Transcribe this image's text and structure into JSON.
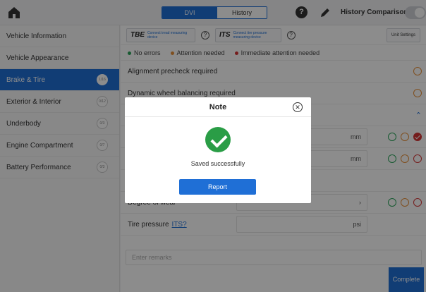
{
  "header": {
    "home_icon": "home-icon",
    "tabs": [
      "DVI",
      "History"
    ],
    "active_tab": "DVI",
    "history_comparison_label": "History Comparison",
    "history_comparison_on": false
  },
  "sidebar": {
    "items": [
      {
        "label": "Vehicle Information",
        "badge": ""
      },
      {
        "label": "Vehicle Appearance",
        "badge": ""
      },
      {
        "label": "Brake & Tire",
        "badge": "1/16",
        "active": true
      },
      {
        "label": "Exterior & Interior",
        "badge": "0/12"
      },
      {
        "label": "Underbody",
        "badge": "0/3"
      },
      {
        "label": "Engine Compartment",
        "badge": "0/7"
      },
      {
        "label": "Battery Performance",
        "badge": "0/3"
      }
    ]
  },
  "toolbar": {
    "tbe_logo": "TBE",
    "tbe_text": "Connect tread measuring device",
    "its_logo": "ITS",
    "its_text": "Connect tire pressure measuring device",
    "unit_settings": "Unit Settings"
  },
  "legend": {
    "no_errors": "No errors",
    "attention": "Attention needed",
    "immediate": "Immediate attention needed"
  },
  "rows": {
    "alignment": "Alignment precheck required",
    "dynamic_balancing": "Dynamic wheel balancing required",
    "mm_unit": "mm",
    "degree_of_wear": "Degree of wear",
    "tire_pressure": "Tire pressure",
    "its_link": "ITS?",
    "psi_unit": "psi",
    "remarks_placeholder": "Enter remarks"
  },
  "footer": {
    "complete": "Complete"
  },
  "modal": {
    "title": "Note",
    "message": "Saved successfully",
    "button": "Report"
  },
  "colors": {
    "accent": "#1f6fd6",
    "success": "#2a9d46",
    "green": "#2aa55a",
    "orange": "#e8913a",
    "red": "#d63636"
  }
}
